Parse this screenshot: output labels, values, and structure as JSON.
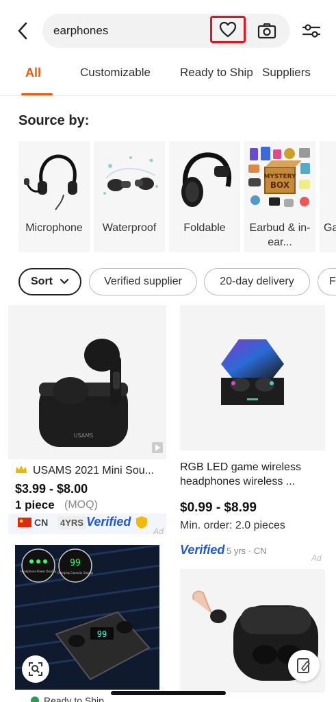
{
  "search": {
    "query": "earphones"
  },
  "tabs": [
    "All",
    "Customizable",
    "Ready to Ship",
    "Suppliers"
  ],
  "source_by": {
    "title": "Source by:",
    "items": [
      {
        "label": "Microphone"
      },
      {
        "label": "Waterproof"
      },
      {
        "label": "Foldable"
      },
      {
        "label": "Earbud & in-ear..."
      },
      {
        "label": "Ga"
      }
    ]
  },
  "chips": {
    "sort": "Sort",
    "verified": "Verified supplier",
    "delivery": "20-day delivery",
    "more": "F"
  },
  "products": [
    {
      "title": "USAMS 2021 Mini Sou...",
      "price": "$3.99 - $8.00",
      "moq_qty": "1 piece",
      "moq_label": "(MOQ)",
      "country": "CN",
      "years": "4YRS",
      "verified": "Verified",
      "ad": "Ad",
      "brand_on_case": "USAMS"
    },
    {
      "title_line1": "RGB LED game wireless",
      "title_line2": "headphones wireless ...",
      "price": "$0.99 - $8.99",
      "min_order": "Min. order: 2.0 pieces",
      "verified": "Verified",
      "years_country": "5 yrs · CN",
      "ad": "Ad"
    },
    {
      "display_top": "99",
      "display_label1": "Headphone Power Display",
      "display_label2": "Charging Capacity Display",
      "case_display": "99",
      "footer": "Ready to Ship"
    },
    {}
  ],
  "colors": {
    "accent": "#f25a0c",
    "verified": "#1c57d8",
    "highlight": "#e0151d"
  }
}
